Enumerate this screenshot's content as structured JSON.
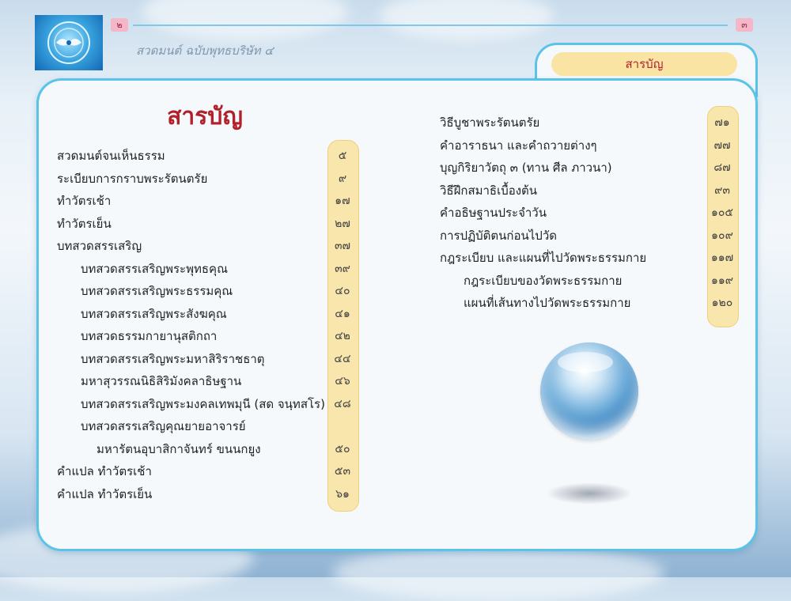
{
  "header": {
    "page_left": "๒",
    "page_right": "๓",
    "book_title": "สวดมนต์ ฉบับพุทธบริษัท ๔",
    "tab_label": "สารบัญ"
  },
  "page_title": "สารบัญ",
  "left_toc": [
    {
      "label": "สวดมนต์จนเห็นธรรม",
      "page": "๕",
      "indent": 0
    },
    {
      "label": "ระเบียบการกราบพระรัตนตรัย",
      "page": "๙",
      "indent": 0
    },
    {
      "label": "ทำวัตรเช้า",
      "page": "๑๗",
      "indent": 0
    },
    {
      "label": "ทำวัตรเย็น",
      "page": "๒๗",
      "indent": 0
    },
    {
      "label": "บทสวดสรรเสริญ",
      "page": "๓๗",
      "indent": 0
    },
    {
      "label": "บทสวดสรรเสริญพระพุทธคุณ",
      "page": "๓๙",
      "indent": 1
    },
    {
      "label": "บทสวดสรรเสริญพระธรรมคุณ",
      "page": "๔๐",
      "indent": 1
    },
    {
      "label": "บทสวดสรรเสริญพระสังฆคุณ",
      "page": "๔๑",
      "indent": 1
    },
    {
      "label": "บทสวดธรรมกายานุสติกถา",
      "page": "๔๒",
      "indent": 1
    },
    {
      "label": "บทสวดสรรเสริญพระมหาสิริราชธาตุ",
      "page": "๔๔",
      "indent": 1
    },
    {
      "label": "มหาสุวรรณนิธิสิริมังคลาธิษฐาน",
      "page": "๔๖",
      "indent": 1
    },
    {
      "label": "บทสวดสรรเสริญพระมงคลเทพมุนี (สด จนฺทสโร)",
      "page": "๔๘",
      "indent": 1
    },
    {
      "label": "บทสวดสรรเสริญคุณยายอาจารย์",
      "page": "",
      "indent": 1
    },
    {
      "label": "มหารัตนอุบาสิกาจันทร์ ขนนกยูง",
      "page": "๕๐",
      "indent": 2
    },
    {
      "label": "คำแปล  ทำวัตรเช้า",
      "page": "๕๓",
      "indent": 0
    },
    {
      "label": "คำแปล  ทำวัตรเย็น",
      "page": "๖๑",
      "indent": 0
    }
  ],
  "right_toc": [
    {
      "label": "วิธีบูชาพระรัตนตรัย",
      "page": "๗๑",
      "indent": 0
    },
    {
      "label": "คำอาราธนา และคำถวายต่างๆ",
      "page": "๗๗",
      "indent": 0
    },
    {
      "label": "บุญกิริยาวัตถุ ๓ (ทาน ศีล ภาวนา)",
      "page": "๘๗",
      "indent": 0
    },
    {
      "label": "วิธีฝึกสมาธิเบื้องต้น",
      "page": "๙๓",
      "indent": 0
    },
    {
      "label": "คำอธิษฐานประจำวัน",
      "page": "๑๐๕",
      "indent": 0
    },
    {
      "label": "การปฏิบัติตนก่อนไปวัด",
      "page": "๑๐๙",
      "indent": 0
    },
    {
      "label": "กฎระเบียบ และแผนที่ไปวัดพระธรรมกาย",
      "page": "๑๑๗",
      "indent": 0
    },
    {
      "label": "กฎระเบียบของวัดพระธรรมกาย",
      "page": "๑๑๙",
      "indent": 1
    },
    {
      "label": "แผนที่เส้นทางไปวัดพระธรรมกาย",
      "page": "๑๒๐",
      "indent": 1
    }
  ],
  "colors": {
    "title_red": "#b1212b",
    "frame_blue": "#5cc3e8",
    "page_strip": "#f9e6ac",
    "page_badge": "#f3b7c8"
  },
  "icons": {
    "logo": "dhammakaya-emblem-icon",
    "decoration": "crystal-sphere"
  }
}
